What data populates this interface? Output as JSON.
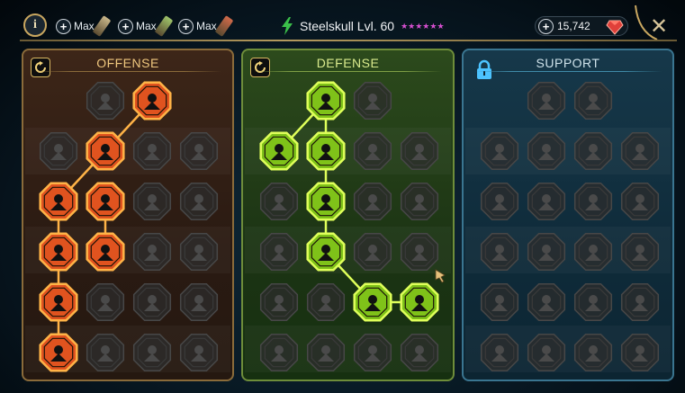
{
  "topbar": {
    "info_label": "i",
    "boosts": [
      {
        "label": "Max",
        "color": "#c9b78a"
      },
      {
        "label": "Max",
        "color": "#9ec46a"
      },
      {
        "label": "Max",
        "color": "#d06a4a"
      }
    ],
    "champion_name": "Steelskull Lvl. 60",
    "champion_stars": 6,
    "gems_value": "15,742",
    "close_label": "✕"
  },
  "colors": {
    "offense_active": "#e0531f",
    "offense_glow": "#ffb347",
    "defense_active": "#7fc219",
    "defense_glow": "#dfff5a",
    "locked_fill": "#2c2c2c",
    "locked_stroke": "#474747"
  },
  "panels": [
    {
      "id": "offense",
      "title": "OFFENSE",
      "control": "reset-icon",
      "nodes": [
        {
          "row": 0,
          "col": 1,
          "state": "locked",
          "icon": "crossed-swords-icon"
        },
        {
          "row": 0,
          "col": 2,
          "state": "active",
          "icon": "blade-strike-icon"
        },
        {
          "row": 1,
          "col": 0,
          "state": "locked",
          "icon": "demon-face-icon"
        },
        {
          "row": 1,
          "col": 1,
          "state": "active",
          "icon": "claw-slash-icon"
        },
        {
          "row": 1,
          "col": 2,
          "state": "locked",
          "icon": "helmet-icon"
        },
        {
          "row": 1,
          "col": 3,
          "state": "locked",
          "icon": "fang-icon"
        },
        {
          "row": 2,
          "col": 0,
          "state": "active",
          "icon": "warrior-strike-icon"
        },
        {
          "row": 2,
          "col": 1,
          "state": "active",
          "icon": "jaws-icon"
        },
        {
          "row": 2,
          "col": 2,
          "state": "locked",
          "icon": "skull-icon"
        },
        {
          "row": 2,
          "col": 3,
          "state": "locked",
          "icon": "axe-icon"
        },
        {
          "row": 3,
          "col": 0,
          "state": "active",
          "icon": "heart-pierce-icon"
        },
        {
          "row": 3,
          "col": 1,
          "state": "active",
          "icon": "fist-sword-icon"
        },
        {
          "row": 3,
          "col": 2,
          "state": "locked",
          "icon": "hammer-icon"
        },
        {
          "row": 3,
          "col": 3,
          "state": "locked",
          "icon": "trident-icon"
        },
        {
          "row": 4,
          "col": 0,
          "state": "active",
          "icon": "bleeding-hand-icon"
        },
        {
          "row": 4,
          "col": 1,
          "state": "locked",
          "icon": "skull-icon"
        },
        {
          "row": 4,
          "col": 2,
          "state": "locked",
          "icon": "spear-icon"
        },
        {
          "row": 4,
          "col": 3,
          "state": "locked",
          "icon": "brute-icon"
        },
        {
          "row": 5,
          "col": 0,
          "state": "active",
          "icon": "sparkle-strike-icon"
        },
        {
          "row": 5,
          "col": 1,
          "state": "locked",
          "icon": "knight-helm-icon"
        },
        {
          "row": 5,
          "col": 2,
          "state": "locked",
          "icon": "warrior-icon"
        },
        {
          "row": 5,
          "col": 3,
          "state": "locked",
          "icon": "beast-skull-icon"
        }
      ],
      "links": [
        [
          0,
          2,
          1,
          1
        ],
        [
          1,
          1,
          2,
          0
        ],
        [
          2,
          0,
          3,
          0
        ],
        [
          3,
          0,
          4,
          0
        ],
        [
          4,
          0,
          5,
          0
        ],
        [
          2,
          1,
          3,
          1
        ]
      ]
    },
    {
      "id": "defense",
      "title": "DEFENSE",
      "control": "reset-icon",
      "nodes": [
        {
          "row": 0,
          "col": 1,
          "state": "active",
          "icon": "stairs-shield-icon"
        },
        {
          "row": 0,
          "col": 2,
          "state": "locked",
          "icon": "fist-icon"
        },
        {
          "row": 1,
          "col": 0,
          "state": "active",
          "icon": "chevron-shield-icon"
        },
        {
          "row": 1,
          "col": 1,
          "state": "active",
          "icon": "heart-body-icon"
        },
        {
          "row": 1,
          "col": 2,
          "state": "locked",
          "icon": "tower-icon"
        },
        {
          "row": 1,
          "col": 3,
          "state": "locked",
          "icon": "sword-icon"
        },
        {
          "row": 2,
          "col": 0,
          "state": "locked",
          "icon": "shield-icon"
        },
        {
          "row": 2,
          "col": 1,
          "state": "active",
          "icon": "knight-shield-icon"
        },
        {
          "row": 2,
          "col": 2,
          "state": "locked",
          "icon": "demon-icon"
        },
        {
          "row": 2,
          "col": 3,
          "state": "locked",
          "icon": "face-icon"
        },
        {
          "row": 3,
          "col": 0,
          "state": "locked",
          "icon": "tree-icon"
        },
        {
          "row": 3,
          "col": 1,
          "state": "active",
          "icon": "hourglass-icon"
        },
        {
          "row": 3,
          "col": 2,
          "state": "locked",
          "icon": "hand-icon"
        },
        {
          "row": 3,
          "col": 3,
          "state": "locked",
          "icon": "ogre-icon"
        },
        {
          "row": 4,
          "col": 0,
          "state": "locked",
          "icon": "wings-icon"
        },
        {
          "row": 4,
          "col": 1,
          "state": "locked",
          "icon": "cathedral-icon"
        },
        {
          "row": 4,
          "col": 2,
          "state": "active",
          "icon": "radiant-skull-icon"
        },
        {
          "row": 4,
          "col": 3,
          "state": "active",
          "icon": "reaching-hand-icon"
        },
        {
          "row": 5,
          "col": 0,
          "state": "locked",
          "icon": "crown-icon"
        },
        {
          "row": 5,
          "col": 1,
          "state": "locked",
          "icon": "mask-icon"
        },
        {
          "row": 5,
          "col": 2,
          "state": "locked",
          "icon": "fire-icon"
        },
        {
          "row": 5,
          "col": 3,
          "state": "locked",
          "icon": "boot-icon"
        }
      ],
      "links": [
        [
          0,
          1,
          1,
          0
        ],
        [
          0,
          1,
          1,
          1
        ],
        [
          1,
          1,
          2,
          1
        ],
        [
          2,
          1,
          3,
          1
        ],
        [
          3,
          1,
          4,
          2
        ],
        [
          4,
          2,
          4,
          3
        ]
      ]
    },
    {
      "id": "support",
      "title": "SUPPORT",
      "control": "lock-icon",
      "nodes": [
        {
          "row": 0,
          "col": 1,
          "state": "locked",
          "icon": "heart-icon"
        },
        {
          "row": 0,
          "col": 2,
          "state": "locked",
          "icon": "shield-icon"
        },
        {
          "row": 1,
          "col": 0,
          "state": "locked",
          "icon": "hand-icon"
        },
        {
          "row": 1,
          "col": 1,
          "state": "locked",
          "icon": "fingerprint-icon"
        },
        {
          "row": 1,
          "col": 2,
          "state": "locked",
          "icon": "boot-icon"
        },
        {
          "row": 1,
          "col": 3,
          "state": "locked",
          "icon": "horse-icon"
        },
        {
          "row": 2,
          "col": 0,
          "state": "locked",
          "icon": "helm-icon"
        },
        {
          "row": 2,
          "col": 1,
          "state": "locked",
          "icon": "lightning-icon"
        },
        {
          "row": 2,
          "col": 2,
          "state": "locked",
          "icon": "swirl-icon"
        },
        {
          "row": 2,
          "col": 3,
          "state": "locked",
          "icon": "statue-icon"
        },
        {
          "row": 3,
          "col": 0,
          "state": "locked",
          "icon": "heart-ring-icon"
        },
        {
          "row": 3,
          "col": 1,
          "state": "locked",
          "icon": "wind-icon"
        },
        {
          "row": 3,
          "col": 2,
          "state": "locked",
          "icon": "book-icon"
        },
        {
          "row": 3,
          "col": 3,
          "state": "locked",
          "icon": "burst-icon"
        },
        {
          "row": 4,
          "col": 0,
          "state": "locked",
          "icon": "cross-icon"
        },
        {
          "row": 4,
          "col": 1,
          "state": "locked",
          "icon": "dash-icon"
        },
        {
          "row": 4,
          "col": 2,
          "state": "locked",
          "icon": "sword-icon"
        },
        {
          "row": 4,
          "col": 3,
          "state": "locked",
          "icon": "eye-icon"
        },
        {
          "row": 5,
          "col": 0,
          "state": "locked",
          "icon": "mask-icon"
        },
        {
          "row": 5,
          "col": 1,
          "state": "locked",
          "icon": "skull-icon"
        },
        {
          "row": 5,
          "col": 2,
          "state": "locked",
          "icon": "wing-icon"
        },
        {
          "row": 5,
          "col": 3,
          "state": "locked",
          "icon": "eagle-icon"
        }
      ],
      "links": []
    }
  ]
}
